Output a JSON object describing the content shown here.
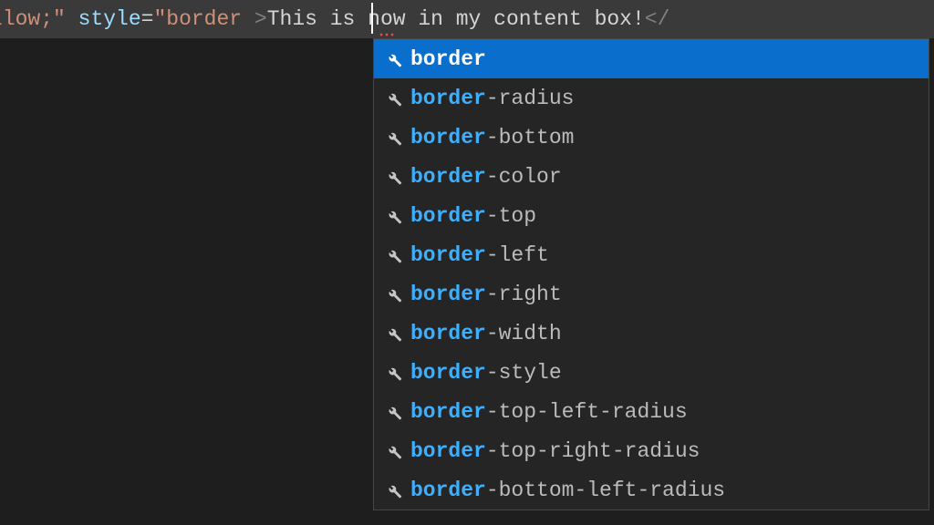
{
  "code": {
    "segments": [
      {
        "cls": "tok-str",
        "text": "ox-yellow;\""
      },
      {
        "cls": "tok-text",
        "text": " "
      },
      {
        "cls": "tok-attr",
        "text": "style"
      },
      {
        "cls": "tok-punct",
        "text": "="
      },
      {
        "cls": "tok-str",
        "text": "\"border"
      },
      {
        "cls": "tok-text",
        "text": " "
      },
      {
        "cls": "tok-bracket",
        "text": ">"
      },
      {
        "cls": "tok-text",
        "text": "This is now in my content box!"
      },
      {
        "cls": "tok-bracket",
        "text": "</"
      }
    ]
  },
  "suggest": {
    "highlight": "border",
    "items": [
      {
        "label": "border",
        "selected": true
      },
      {
        "label": "border-radius",
        "selected": false
      },
      {
        "label": "border-bottom",
        "selected": false
      },
      {
        "label": "border-color",
        "selected": false
      },
      {
        "label": "border-top",
        "selected": false
      },
      {
        "label": "border-left",
        "selected": false
      },
      {
        "label": "border-right",
        "selected": false
      },
      {
        "label": "border-width",
        "selected": false
      },
      {
        "label": "border-style",
        "selected": false
      },
      {
        "label": "border-top-left-radius",
        "selected": false
      },
      {
        "label": "border-top-right-radius",
        "selected": false
      },
      {
        "label": "border-bottom-left-radius",
        "selected": false
      }
    ]
  }
}
